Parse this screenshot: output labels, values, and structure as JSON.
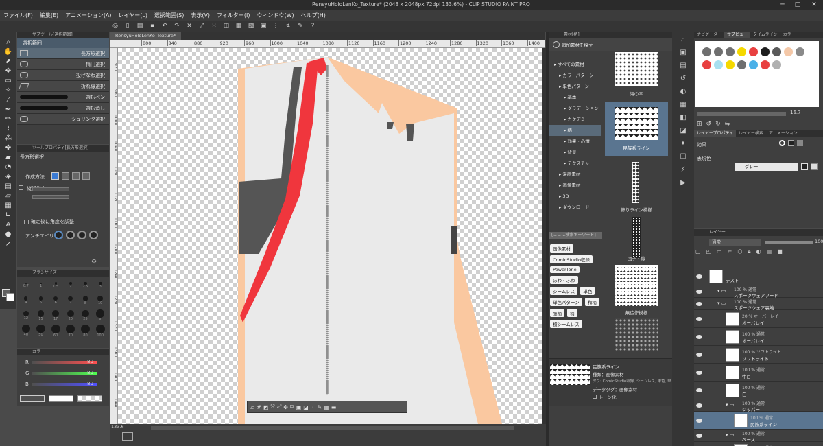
{
  "window": {
    "title": "RensyuHoloLenKo_Texture* (2048 x 2048px 72dpi 133.6%) - CLIP STUDIO PAINT PRO",
    "minimize": "─",
    "maximize": "□",
    "close": "✕"
  },
  "menu": [
    "ファイル(F)",
    "編集(E)",
    "アニメーション(A)",
    "レイヤー(L)",
    "選択範囲(S)",
    "表示(V)",
    "フィルター(I)",
    "ウィンドウ(W)",
    "ヘルプ(H)"
  ],
  "doc_tab": "RensyuHoloLenKo_Texture*",
  "subtool": {
    "header": "サブツール[選択範囲]",
    "tab": "選択範囲",
    "items": [
      "長方形選択",
      "楕円選択",
      "投げなわ選択",
      "折れ線選択",
      "選択ペン",
      "選択消し",
      "シュリンク選択"
    ]
  },
  "tool_property": {
    "header": "ツールプロパティ[長方形選択]",
    "title": "長方形選択",
    "create_method_label": "作成方法",
    "aspect_label": "縦横指定",
    "angle_label": "確定後に角度を調整",
    "antialias_label": "アンチエイリアス"
  },
  "brush_size": {
    "header": "ブラシサイズ",
    "sizes": [
      "0.7",
      "1",
      "1.5",
      "2",
      "2.5",
      "3",
      "4",
      "5",
      "6",
      "7",
      "8",
      "10",
      "12",
      "15",
      "17",
      "20",
      "25",
      "30",
      "40",
      "50",
      "60",
      "70",
      "80",
      "100"
    ]
  },
  "color_slider": {
    "header": "カラー",
    "r_label": "R",
    "r_value": "80",
    "g_label": "G",
    "g_value": "80",
    "b_label": "B",
    "b_value": "80"
  },
  "ruler": {
    "h_ticks": [
      "800",
      "840",
      "880",
      "920",
      "960",
      "1000",
      "1040",
      "1080",
      "1120",
      "1160",
      "1200",
      "1240",
      "1280",
      "1320",
      "1360",
      "1400",
      "1440"
    ],
    "v_ticks": [
      "920",
      "960",
      "1000",
      "1040",
      "1080",
      "1120",
      "1160",
      "1200",
      "1240",
      "1280",
      "1320",
      "1360",
      "1400",
      "1440",
      "1480",
      "1520"
    ]
  },
  "zoom_readout": "133.6",
  "material": {
    "header": "素材[柄]",
    "add_button": "追加素材を探す",
    "tree": [
      "すべての素材",
      "カラーパターン",
      "単色パターン",
      "基本",
      "グラデーション",
      "カケアミ",
      "柄",
      "効果・心情",
      "背景",
      "テクスチャ",
      "漫画素材",
      "画像素材",
      "3D",
      "ダウンロード"
    ],
    "search_placeholder": "[ここに検索キーワード]",
    "tags": [
      "画像素材",
      "ComicStudio収録",
      "PowerTone",
      "ほわ・ふわ",
      "シームレス",
      "単色",
      "単色パターン",
      "和柄",
      "服柄",
      "柄",
      "横シームレス"
    ],
    "thumbs": [
      "海の幸",
      "民族系ライン",
      "飾りライン模様",
      "団子・線",
      "無造作模様"
    ],
    "detail": {
      "name": "民族系ライン",
      "kind": "種類：画像素材",
      "tags": "タグ: ComicStudio収録, シームレス, 単色, 単色パ",
      "data_tag": "データタグ：画像素材",
      "tone": "トーン化"
    }
  },
  "navigator": {
    "tabs": [
      "ナビゲーター",
      "サブビュー",
      "タイムライン",
      "カラー"
    ],
    "zoom_value": "16.7",
    "palette": [
      "#6f6f6f",
      "#6f6f6f",
      "#6f6f6f",
      "#f5d800",
      "#e84040",
      "#1e1e1e",
      "#5a5a5a",
      "#f4c8a8",
      "#8a8a8a",
      "#e84040",
      "#a8e0f0",
      "#f5d800",
      "#6f6f6f",
      "#4ab0e8",
      "#e84040",
      "#b0b0b0"
    ]
  },
  "layer_property": {
    "tabs": [
      "レイヤープロパティ",
      "レイヤー検索",
      "アニメーション"
    ],
    "effect_label": "効果",
    "expression_label": "表現色",
    "expression_value": "グレー"
  },
  "layers": {
    "tab": "レイヤー",
    "blend_mode": "通常",
    "opacity": "100",
    "rows": [
      {
        "l1": "",
        "l2": "テスト"
      },
      {
        "l1": "100 % 通常",
        "l2": "スポーツウェアフード"
      },
      {
        "l1": "100 % 通常",
        "l2": "スポーツウェア裏地"
      },
      {
        "l1": "20 % オーバーレイ",
        "l2": "オーバレイ"
      },
      {
        "l1": "100 % 通常",
        "l2": "オーバレイ"
      },
      {
        "l1": "100 % ソフトライト",
        "l2": "ソフトライト"
      },
      {
        "l1": "100 % 通常",
        "l2": "中目"
      },
      {
        "l1": "100 % 通常",
        "l2": "白"
      },
      {
        "l1": "100 % 通常",
        "l2": "ジッパー"
      },
      {
        "l1": "100 % 通常",
        "l2": "民族系ライン"
      },
      {
        "l1": "100 % 通常",
        "l2": "ベース"
      },
      {
        "l1": "100 % 通常",
        "l2": "ベースライン"
      }
    ]
  }
}
